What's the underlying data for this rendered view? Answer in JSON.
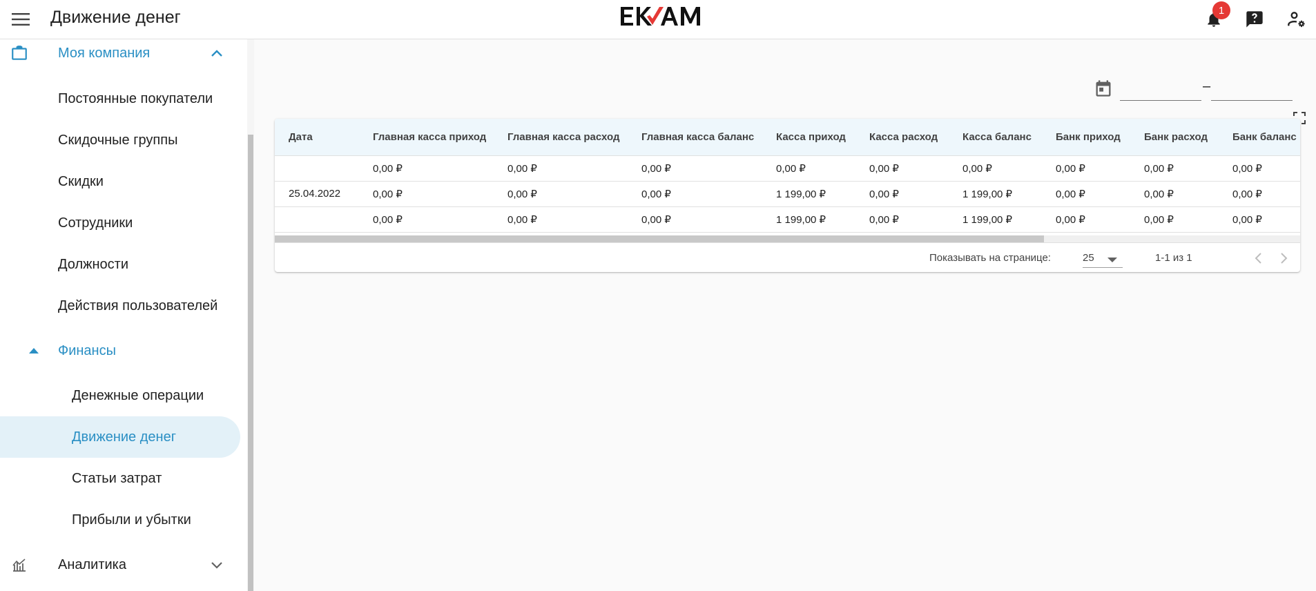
{
  "header": {
    "title": "Движение денег",
    "logo_text": "EKAM",
    "notifications_count": "1"
  },
  "colors": {
    "accent": "#2a8fc4",
    "active_bg": "#e3f1f8",
    "badge": "#e53935",
    "logo_red": "#e53935"
  },
  "sidebar": {
    "company": {
      "label": "Моя компания",
      "icon": "briefcase-icon",
      "expanded": true
    },
    "company_items": [
      {
        "label": "Постоянные покупатели"
      },
      {
        "label": "Скидочные группы"
      },
      {
        "label": "Скидки"
      },
      {
        "label": "Сотрудники"
      },
      {
        "label": "Должности"
      },
      {
        "label": "Действия пользователей"
      }
    ],
    "finance": {
      "label": "Финансы",
      "expanded": true
    },
    "finance_items": [
      {
        "label": "Денежные операции",
        "active": false
      },
      {
        "label": "Движение денег",
        "active": true
      },
      {
        "label": "Статьи затрат",
        "active": false
      },
      {
        "label": "Прибыли и убытки",
        "active": false
      }
    ],
    "analytics": {
      "label": "Аналитика",
      "icon": "analytics-icon",
      "expanded": false
    }
  },
  "filters": {
    "date_from": "",
    "date_to": "",
    "separator": "–"
  },
  "table": {
    "columns": [
      "Дата",
      "Главная касса приход",
      "Главная касса расход",
      "Главная касса баланс",
      "Касса приход",
      "Касса расход",
      "Касса баланс",
      "Банк приход",
      "Банк расход",
      "Банк баланс"
    ],
    "rows": [
      [
        "",
        "0,00 ₽",
        "0,00 ₽",
        "0,00 ₽",
        "0,00 ₽",
        "0,00 ₽",
        "0,00 ₽",
        "0,00 ₽",
        "0,00 ₽",
        "0,00 ₽"
      ],
      [
        "25.04.2022",
        "0,00 ₽",
        "0,00 ₽",
        "0,00 ₽",
        "1 199,00 ₽",
        "0,00 ₽",
        "1 199,00 ₽",
        "0,00 ₽",
        "0,00 ₽",
        "0,00 ₽"
      ],
      [
        "",
        "0,00 ₽",
        "0,00 ₽",
        "0,00 ₽",
        "1 199,00 ₽",
        "0,00 ₽",
        "1 199,00 ₽",
        "0,00 ₽",
        "0,00 ₽",
        "0,00 ₽"
      ]
    ]
  },
  "pagination": {
    "rows_per_page_label": "Показывать на странице:",
    "rows_per_page": "25",
    "range": "1-1 из 1"
  }
}
